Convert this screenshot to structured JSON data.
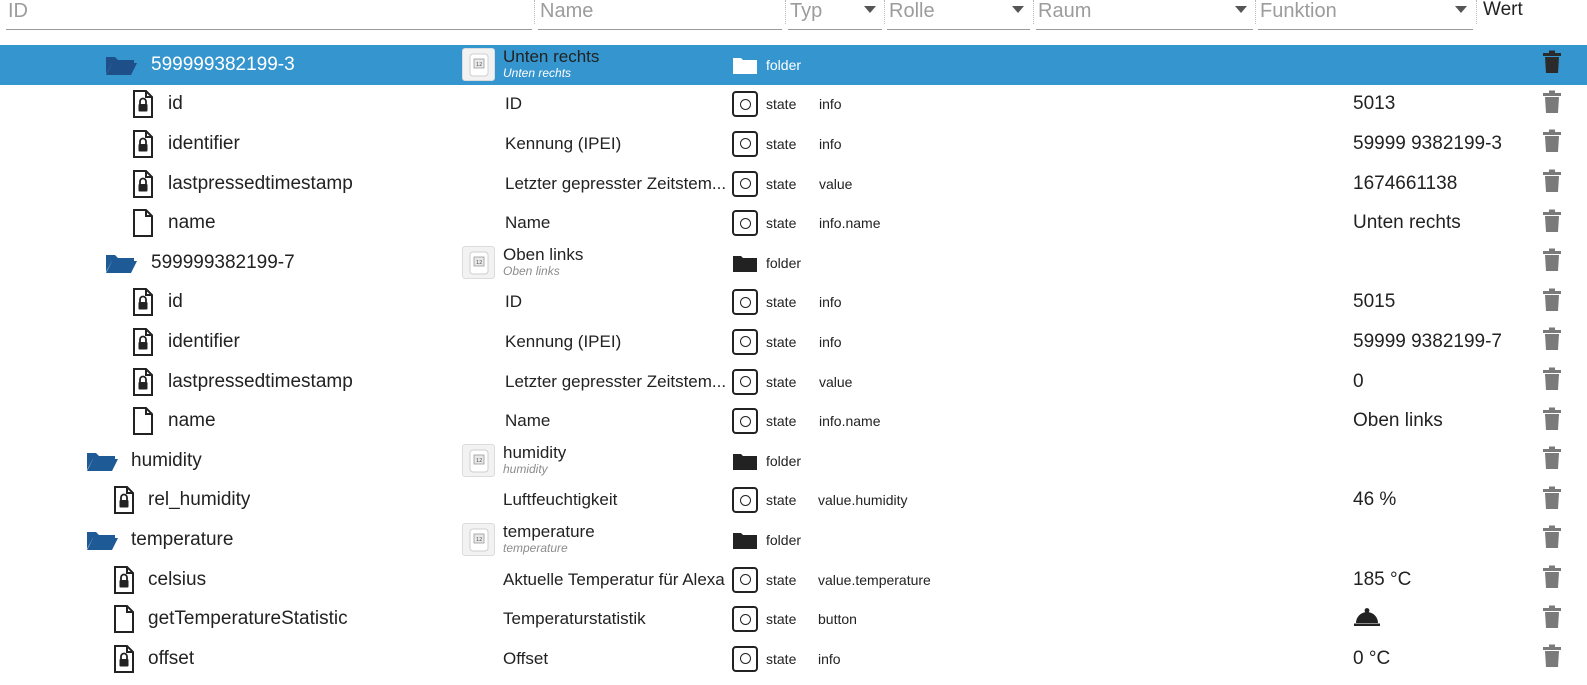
{
  "header": {
    "filters": [
      {
        "placeholder": "ID"
      },
      {
        "placeholder": "Name"
      },
      {
        "placeholder": "Typ"
      },
      {
        "placeholder": "Rolle"
      },
      {
        "placeholder": "Raum"
      },
      {
        "placeholder": "Funktion"
      }
    ],
    "wert_label": "Wert"
  },
  "colors": {
    "selected_row": "#3595cf",
    "folder_icon": "#1e5a96",
    "trash_icon": "#7a7a7a"
  },
  "rows": [
    {
      "kind": "folder",
      "id": "599999382199-3",
      "name": "Unten rechts",
      "name_sub": "Unten rechts",
      "type": "folder",
      "role": "",
      "value": "",
      "selected": true
    },
    {
      "kind": "state",
      "id": "id",
      "name": "ID",
      "type": "state",
      "role": "info",
      "value": "5013",
      "locked": true
    },
    {
      "kind": "state",
      "id": "identifier",
      "name": "Kennung (IPEI)",
      "type": "state",
      "role": "info",
      "value": "59999 9382199-3",
      "locked": true
    },
    {
      "kind": "state",
      "id": "lastpressedtimestamp",
      "name": "Letzter gepresster Zeitstem...",
      "type": "state",
      "role": "value",
      "value": "1674661138",
      "locked": true
    },
    {
      "kind": "state",
      "id": "name",
      "name": "Name",
      "type": "state",
      "role": "info.name",
      "value": "Unten rechts",
      "locked": false
    },
    {
      "kind": "folder",
      "id": "599999382199-7",
      "name": "Oben links",
      "name_sub": "Oben links",
      "type": "folder",
      "role": "",
      "value": ""
    },
    {
      "kind": "state",
      "id": "id",
      "name": "ID",
      "type": "state",
      "role": "info",
      "value": "5015",
      "locked": true
    },
    {
      "kind": "state",
      "id": "identifier",
      "name": "Kennung (IPEI)",
      "type": "state",
      "role": "info",
      "value": "59999 9382199-7",
      "locked": true
    },
    {
      "kind": "state",
      "id": "lastpressedtimestamp",
      "name": "Letzter gepresster Zeitstem...",
      "type": "state",
      "role": "value",
      "value": "0",
      "locked": true
    },
    {
      "kind": "state",
      "id": "name",
      "name": "Name",
      "type": "state",
      "role": "info.name",
      "value": "Oben links",
      "locked": false
    },
    {
      "kind": "folder",
      "id": "humidity",
      "name": "humidity",
      "name_sub": "humidity",
      "type": "folder",
      "role": "",
      "value": ""
    },
    {
      "kind": "state",
      "id": "rel_humidity",
      "name": "Luftfeuchtigkeit",
      "type": "state",
      "role": "value.humidity",
      "value": "46 %",
      "locked": true
    },
    {
      "kind": "folder",
      "id": "temperature",
      "name": "temperature",
      "name_sub": "temperature",
      "type": "folder",
      "role": "",
      "value": ""
    },
    {
      "kind": "state",
      "id": "celsius",
      "name": "Aktuelle Temperatur für Alexa",
      "type": "state",
      "role": "value.temperature",
      "value": "185 °C",
      "locked": true
    },
    {
      "kind": "state",
      "id": "getTemperatureStatistic",
      "name": "Temperaturstatistik",
      "type": "state",
      "role": "button",
      "value": "",
      "value_icon": "bell-icon",
      "locked": false
    },
    {
      "kind": "state",
      "id": "offset",
      "name": "Offset",
      "type": "state",
      "role": "info",
      "value": "0 °C",
      "locked": true
    }
  ]
}
